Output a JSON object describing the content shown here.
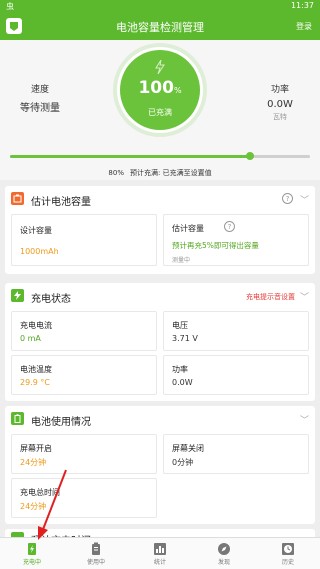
{
  "status_bar": {
    "left_glyph": "虫",
    "time": "11:37"
  },
  "app": {
    "title": "电池容量检测管理",
    "login_label": "登录",
    "accent": "#5cb82c"
  },
  "hero": {
    "speed_label": "速度",
    "speed_value": "等待测量",
    "percent": "100",
    "percent_unit": "%",
    "state": "已充满",
    "power_label": "功率",
    "power_value": "0.0W",
    "power_sub": "瓦特",
    "slider_percent": 80,
    "slider_label": "80%",
    "slider_desc": "预计充满: 已充满至设置值"
  },
  "capacity_card": {
    "title": "估计电池容量",
    "design_label": "设计容量",
    "design_value": "1000mAh",
    "est_label": "估计容量",
    "est_value": "预计再充5%即可得出容量",
    "est_sub": "测量中"
  },
  "charge_card": {
    "title": "充电状态",
    "notify_label": "充电提示音设置",
    "current_label": "充电电流",
    "current_value": "0 mA",
    "voltage_label": "电压",
    "voltage_value": "3.71 V",
    "temp_label": "电池温度",
    "temp_value": "29.9 °C",
    "power_label": "功率",
    "power_value": "0.0W"
  },
  "usage_card": {
    "title": "电池使用情况",
    "screen_on_label": "屏幕开启",
    "screen_on_value": "24分钟",
    "screen_off_label": "屏幕关闭",
    "screen_off_value": "0分钟",
    "total_label": "充电总时间",
    "total_value": "24分钟"
  },
  "next_card": {
    "title": "预计充电时间"
  },
  "bottom_nav": [
    {
      "label": "充电中",
      "icon": "battery-charging-icon",
      "active": true
    },
    {
      "label": "使用中",
      "icon": "battery-icon",
      "active": false
    },
    {
      "label": "统计",
      "icon": "chart-icon",
      "active": false
    },
    {
      "label": "发现",
      "icon": "compass-icon",
      "active": false
    },
    {
      "label": "历史",
      "icon": "clock-icon",
      "active": false
    }
  ]
}
